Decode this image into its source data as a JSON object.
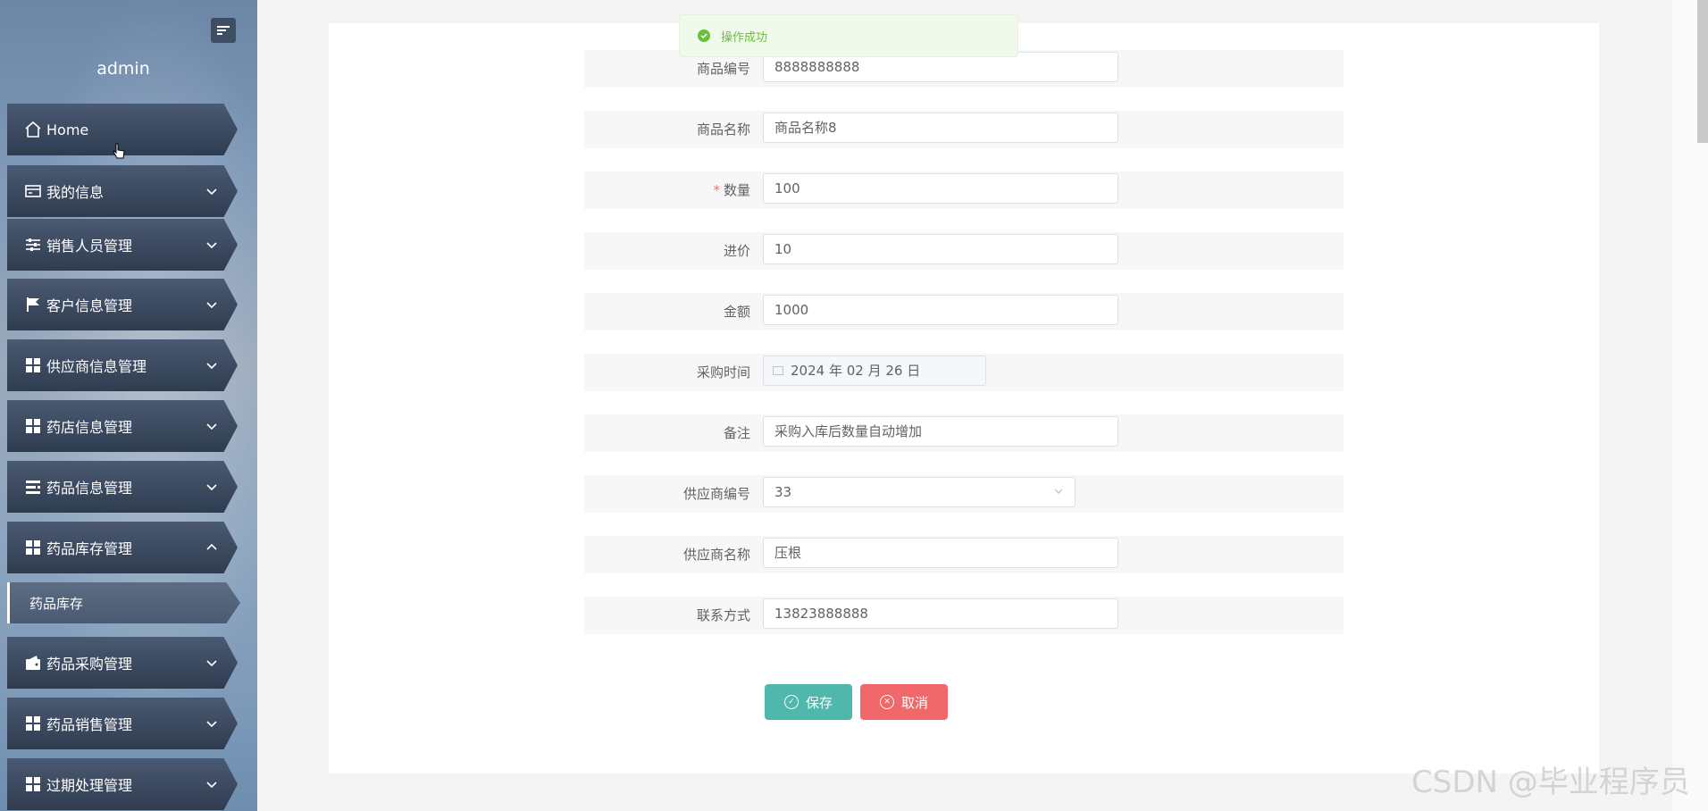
{
  "sidebar": {
    "user": "admin",
    "menu": [
      {
        "label": "Home",
        "icon": "home-icon",
        "has_chevron": false
      },
      {
        "label": "我的信息",
        "icon": "id-card-icon",
        "has_chevron": true
      },
      {
        "label": "销售人员管理",
        "icon": "sliders-icon",
        "has_chevron": true
      },
      {
        "label": "客户信息管理",
        "icon": "flag-icon",
        "has_chevron": true
      },
      {
        "label": "供应商信息管理",
        "icon": "grid-icon",
        "has_chevron": true
      },
      {
        "label": "药店信息管理",
        "icon": "grid-icon",
        "has_chevron": true
      },
      {
        "label": "药品信息管理",
        "icon": "list-icon",
        "has_chevron": true
      },
      {
        "label": "药品库存管理",
        "icon": "grid-icon",
        "has_chevron": true,
        "expanded": true
      },
      {
        "label": "药品采购管理",
        "icon": "wallet-icon",
        "has_chevron": true
      },
      {
        "label": "药品销售管理",
        "icon": "grid-icon",
        "has_chevron": true
      },
      {
        "label": "过期处理管理",
        "icon": "grid-icon",
        "has_chevron": true
      }
    ],
    "submenu": {
      "label": "药品库存"
    }
  },
  "toast": {
    "message": "操作成功",
    "type": "success"
  },
  "form": {
    "fields": [
      {
        "label": "商品编号",
        "value": "8888888888",
        "required": false
      },
      {
        "label": "商品名称",
        "value": "商品名称8",
        "required": false
      },
      {
        "label": "数量",
        "value": "100",
        "required": true
      },
      {
        "label": "进价",
        "value": "10",
        "required": false
      },
      {
        "label": "金额",
        "value": "1000",
        "required": false
      },
      {
        "label": "采购时间",
        "value": "2024 年 02 月 26 日",
        "required": false,
        "type": "date",
        "disabled": true
      },
      {
        "label": "备注",
        "value": "采购入库后数量自动增加",
        "required": false
      },
      {
        "label": "供应商编号",
        "value": "33",
        "required": false,
        "type": "select"
      },
      {
        "label": "供应商名称",
        "value": "压根",
        "required": false
      },
      {
        "label": "联系方式",
        "value": "13823888888",
        "required": false
      }
    ],
    "save_label": "保存",
    "cancel_label": "取消"
  },
  "watermark": "CSDN @毕业程序员",
  "colors": {
    "save": "#4fb7ab",
    "cancel": "#f1686a",
    "success": "#67c23a",
    "required": "#f56c6c",
    "menu_bg": "#3a4860"
  }
}
